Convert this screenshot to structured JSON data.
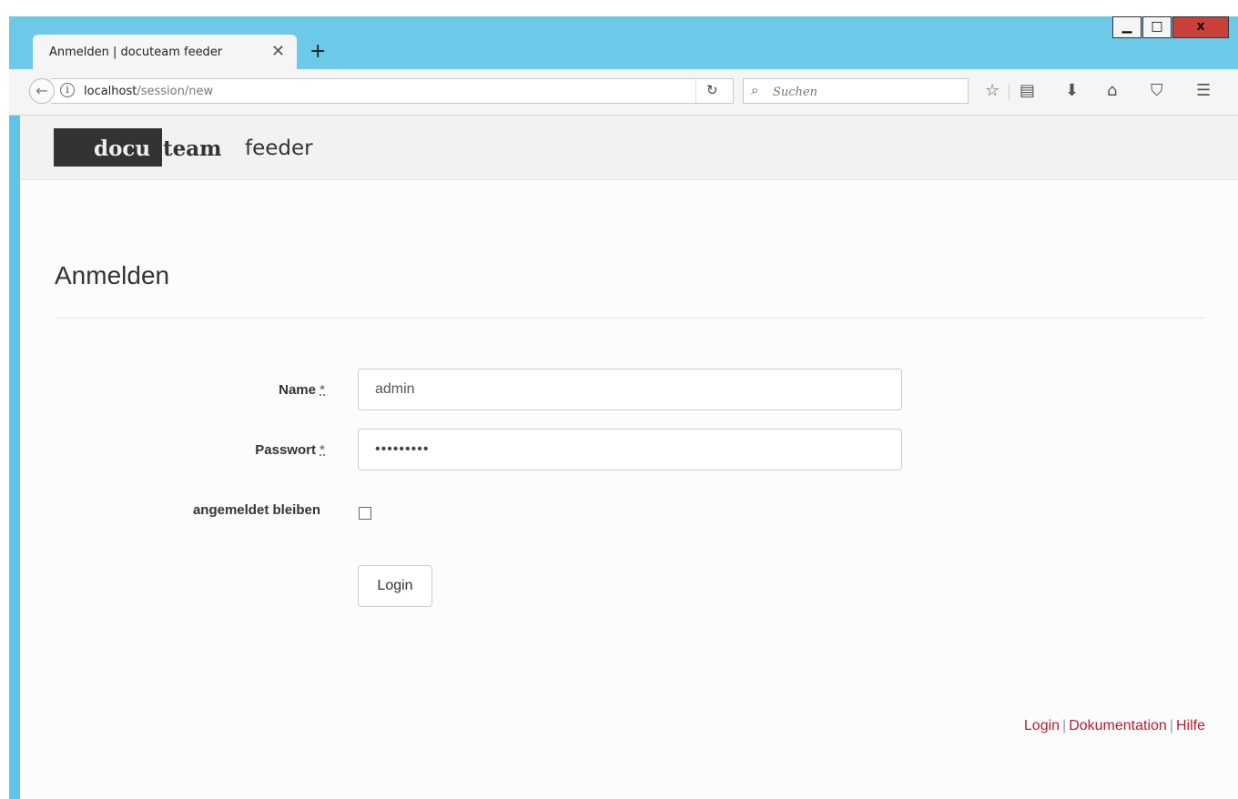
{
  "browser": {
    "tab_title": "Anmelden | docuteam feeder",
    "tab_close": "✕",
    "new_tab": "+",
    "url_host": "localhost",
    "url_path": "/session/new",
    "search_placeholder": "Suchen",
    "window_buttons": {
      "minimize": "▁",
      "maximize": "□",
      "close": "x"
    }
  },
  "logo": {
    "part1": "docu",
    "part2": "team",
    "part3": "feeder"
  },
  "page": {
    "title": "Anmelden"
  },
  "form": {
    "name_label": "Name",
    "password_label": "Passwort",
    "required_marker": "*",
    "name_value": "admin",
    "password_value": "•••••••••",
    "remember_label": "angemeldet bleiben",
    "submit_label": "Login"
  },
  "footer": {
    "links": [
      "Login",
      "Dokumentation",
      "Hilfe"
    ],
    "separator": "|"
  }
}
